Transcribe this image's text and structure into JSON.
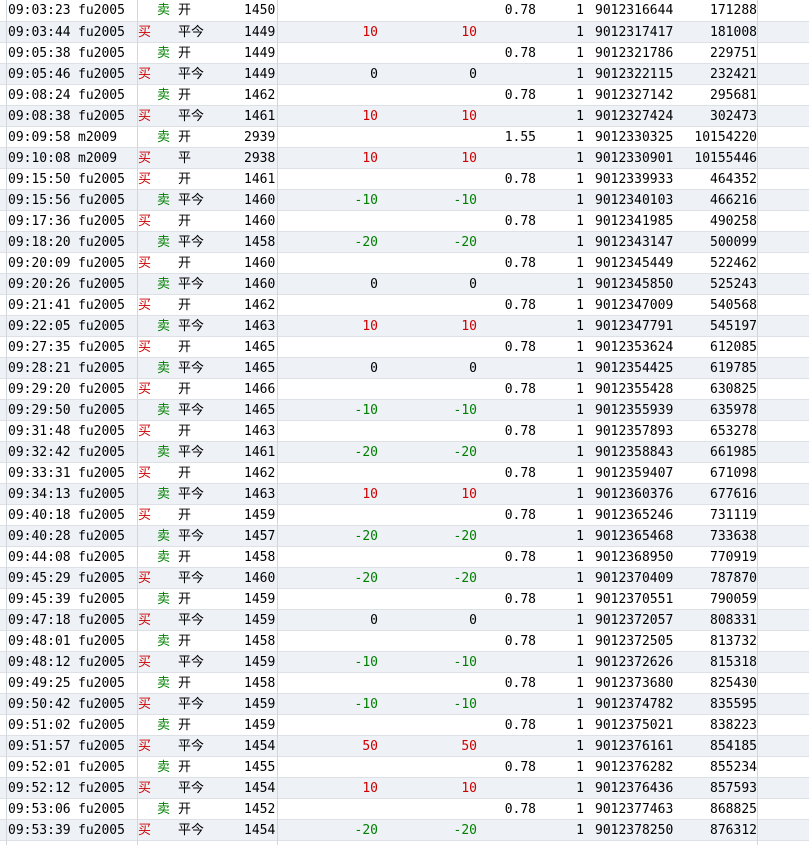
{
  "colors": {
    "buy": "#cc0000",
    "sell": "#008000",
    "row_alt": "#eef1f6"
  },
  "rows": [
    {
      "time": "09:03:23",
      "symbol": "fu2005",
      "side": "卖",
      "oc": "开",
      "price": "1450",
      "pnl1": "",
      "pnl2": "",
      "fee": "0.78",
      "qty": "1",
      "order": "9012316644",
      "trade": "171288"
    },
    {
      "time": "09:03:44",
      "symbol": "fu2005",
      "side": "买",
      "oc": "平今",
      "price": "1449",
      "pnl1": "10",
      "pnl2": "10",
      "fee": "",
      "qty": "1",
      "order": "9012317417",
      "trade": "181008"
    },
    {
      "time": "09:05:38",
      "symbol": "fu2005",
      "side": "卖",
      "oc": "开",
      "price": "1449",
      "pnl1": "",
      "pnl2": "",
      "fee": "0.78",
      "qty": "1",
      "order": "9012321786",
      "trade": "229751"
    },
    {
      "time": "09:05:46",
      "symbol": "fu2005",
      "side": "买",
      "oc": "平今",
      "price": "1449",
      "pnl1": "0",
      "pnl2": "0",
      "fee": "",
      "qty": "1",
      "order": "9012322115",
      "trade": "232421"
    },
    {
      "time": "09:08:24",
      "symbol": "fu2005",
      "side": "卖",
      "oc": "开",
      "price": "1462",
      "pnl1": "",
      "pnl2": "",
      "fee": "0.78",
      "qty": "1",
      "order": "9012327142",
      "trade": "295681"
    },
    {
      "time": "09:08:38",
      "symbol": "fu2005",
      "side": "买",
      "oc": "平今",
      "price": "1461",
      "pnl1": "10",
      "pnl2": "10",
      "fee": "",
      "qty": "1",
      "order": "9012327424",
      "trade": "302473"
    },
    {
      "time": "09:09:58",
      "symbol": "m2009",
      "side": "卖",
      "oc": "开",
      "price": "2939",
      "pnl1": "",
      "pnl2": "",
      "fee": "1.55",
      "qty": "1",
      "order": "9012330325",
      "trade": "10154220"
    },
    {
      "time": "09:10:08",
      "symbol": "m2009",
      "side": "买",
      "oc": "平",
      "price": "2938",
      "pnl1": "10",
      "pnl2": "10",
      "fee": "",
      "qty": "1",
      "order": "9012330901",
      "trade": "10155446"
    },
    {
      "time": "09:15:50",
      "symbol": "fu2005",
      "side": "买",
      "oc": "开",
      "price": "1461",
      "pnl1": "",
      "pnl2": "",
      "fee": "0.78",
      "qty": "1",
      "order": "9012339933",
      "trade": "464352"
    },
    {
      "time": "09:15:56",
      "symbol": "fu2005",
      "side": "卖",
      "oc": "平今",
      "price": "1460",
      "pnl1": "-10",
      "pnl2": "-10",
      "fee": "",
      "qty": "1",
      "order": "9012340103",
      "trade": "466216"
    },
    {
      "time": "09:17:36",
      "symbol": "fu2005",
      "side": "买",
      "oc": "开",
      "price": "1460",
      "pnl1": "",
      "pnl2": "",
      "fee": "0.78",
      "qty": "1",
      "order": "9012341985",
      "trade": "490258"
    },
    {
      "time": "09:18:20",
      "symbol": "fu2005",
      "side": "卖",
      "oc": "平今",
      "price": "1458",
      "pnl1": "-20",
      "pnl2": "-20",
      "fee": "",
      "qty": "1",
      "order": "9012343147",
      "trade": "500099"
    },
    {
      "time": "09:20:09",
      "symbol": "fu2005",
      "side": "买",
      "oc": "开",
      "price": "1460",
      "pnl1": "",
      "pnl2": "",
      "fee": "0.78",
      "qty": "1",
      "order": "9012345449",
      "trade": "522462"
    },
    {
      "time": "09:20:26",
      "symbol": "fu2005",
      "side": "卖",
      "oc": "平今",
      "price": "1460",
      "pnl1": "0",
      "pnl2": "0",
      "fee": "",
      "qty": "1",
      "order": "9012345850",
      "trade": "525243"
    },
    {
      "time": "09:21:41",
      "symbol": "fu2005",
      "side": "买",
      "oc": "开",
      "price": "1462",
      "pnl1": "",
      "pnl2": "",
      "fee": "0.78",
      "qty": "1",
      "order": "9012347009",
      "trade": "540568"
    },
    {
      "time": "09:22:05",
      "symbol": "fu2005",
      "side": "卖",
      "oc": "平今",
      "price": "1463",
      "pnl1": "10",
      "pnl2": "10",
      "fee": "",
      "qty": "1",
      "order": "9012347791",
      "trade": "545197"
    },
    {
      "time": "09:27:35",
      "symbol": "fu2005",
      "side": "买",
      "oc": "开",
      "price": "1465",
      "pnl1": "",
      "pnl2": "",
      "fee": "0.78",
      "qty": "1",
      "order": "9012353624",
      "trade": "612085"
    },
    {
      "time": "09:28:21",
      "symbol": "fu2005",
      "side": "卖",
      "oc": "平今",
      "price": "1465",
      "pnl1": "0",
      "pnl2": "0",
      "fee": "",
      "qty": "1",
      "order": "9012354425",
      "trade": "619785"
    },
    {
      "time": "09:29:20",
      "symbol": "fu2005",
      "side": "买",
      "oc": "开",
      "price": "1466",
      "pnl1": "",
      "pnl2": "",
      "fee": "0.78",
      "qty": "1",
      "order": "9012355428",
      "trade": "630825"
    },
    {
      "time": "09:29:50",
      "symbol": "fu2005",
      "side": "卖",
      "oc": "平今",
      "price": "1465",
      "pnl1": "-10",
      "pnl2": "-10",
      "fee": "",
      "qty": "1",
      "order": "9012355939",
      "trade": "635978"
    },
    {
      "time": "09:31:48",
      "symbol": "fu2005",
      "side": "买",
      "oc": "开",
      "price": "1463",
      "pnl1": "",
      "pnl2": "",
      "fee": "0.78",
      "qty": "1",
      "order": "9012357893",
      "trade": "653278"
    },
    {
      "time": "09:32:42",
      "symbol": "fu2005",
      "side": "卖",
      "oc": "平今",
      "price": "1461",
      "pnl1": "-20",
      "pnl2": "-20",
      "fee": "",
      "qty": "1",
      "order": "9012358843",
      "trade": "661985"
    },
    {
      "time": "09:33:31",
      "symbol": "fu2005",
      "side": "买",
      "oc": "开",
      "price": "1462",
      "pnl1": "",
      "pnl2": "",
      "fee": "0.78",
      "qty": "1",
      "order": "9012359407",
      "trade": "671098"
    },
    {
      "time": "09:34:13",
      "symbol": "fu2005",
      "side": "卖",
      "oc": "平今",
      "price": "1463",
      "pnl1": "10",
      "pnl2": "10",
      "fee": "",
      "qty": "1",
      "order": "9012360376",
      "trade": "677616"
    },
    {
      "time": "09:40:18",
      "symbol": "fu2005",
      "side": "买",
      "oc": "开",
      "price": "1459",
      "pnl1": "",
      "pnl2": "",
      "fee": "0.78",
      "qty": "1",
      "order": "9012365246",
      "trade": "731119"
    },
    {
      "time": "09:40:28",
      "symbol": "fu2005",
      "side": "卖",
      "oc": "平今",
      "price": "1457",
      "pnl1": "-20",
      "pnl2": "-20",
      "fee": "",
      "qty": "1",
      "order": "9012365468",
      "trade": "733638"
    },
    {
      "time": "09:44:08",
      "symbol": "fu2005",
      "side": "卖",
      "oc": "开",
      "price": "1458",
      "pnl1": "",
      "pnl2": "",
      "fee": "0.78",
      "qty": "1",
      "order": "9012368950",
      "trade": "770919"
    },
    {
      "time": "09:45:29",
      "symbol": "fu2005",
      "side": "买",
      "oc": "平今",
      "price": "1460",
      "pnl1": "-20",
      "pnl2": "-20",
      "fee": "",
      "qty": "1",
      "order": "9012370409",
      "trade": "787870"
    },
    {
      "time": "09:45:39",
      "symbol": "fu2005",
      "side": "卖",
      "oc": "开",
      "price": "1459",
      "pnl1": "",
      "pnl2": "",
      "fee": "0.78",
      "qty": "1",
      "order": "9012370551",
      "trade": "790059"
    },
    {
      "time": "09:47:18",
      "symbol": "fu2005",
      "side": "买",
      "oc": "平今",
      "price": "1459",
      "pnl1": "0",
      "pnl2": "0",
      "fee": "",
      "qty": "1",
      "order": "9012372057",
      "trade": "808331"
    },
    {
      "time": "09:48:01",
      "symbol": "fu2005",
      "side": "卖",
      "oc": "开",
      "price": "1458",
      "pnl1": "",
      "pnl2": "",
      "fee": "0.78",
      "qty": "1",
      "order": "9012372505",
      "trade": "813732"
    },
    {
      "time": "09:48:12",
      "symbol": "fu2005",
      "side": "买",
      "oc": "平今",
      "price": "1459",
      "pnl1": "-10",
      "pnl2": "-10",
      "fee": "",
      "qty": "1",
      "order": "9012372626",
      "trade": "815318"
    },
    {
      "time": "09:49:25",
      "symbol": "fu2005",
      "side": "卖",
      "oc": "开",
      "price": "1458",
      "pnl1": "",
      "pnl2": "",
      "fee": "0.78",
      "qty": "1",
      "order": "9012373680",
      "trade": "825430"
    },
    {
      "time": "09:50:42",
      "symbol": "fu2005",
      "side": "买",
      "oc": "平今",
      "price": "1459",
      "pnl1": "-10",
      "pnl2": "-10",
      "fee": "",
      "qty": "1",
      "order": "9012374782",
      "trade": "835595"
    },
    {
      "time": "09:51:02",
      "symbol": "fu2005",
      "side": "卖",
      "oc": "开",
      "price": "1459",
      "pnl1": "",
      "pnl2": "",
      "fee": "0.78",
      "qty": "1",
      "order": "9012375021",
      "trade": "838223"
    },
    {
      "time": "09:51:57",
      "symbol": "fu2005",
      "side": "买",
      "oc": "平今",
      "price": "1454",
      "pnl1": "50",
      "pnl2": "50",
      "fee": "",
      "qty": "1",
      "order": "9012376161",
      "trade": "854185"
    },
    {
      "time": "09:52:01",
      "symbol": "fu2005",
      "side": "卖",
      "oc": "开",
      "price": "1455",
      "pnl1": "",
      "pnl2": "",
      "fee": "0.78",
      "qty": "1",
      "order": "9012376282",
      "trade": "855234"
    },
    {
      "time": "09:52:12",
      "symbol": "fu2005",
      "side": "买",
      "oc": "平今",
      "price": "1454",
      "pnl1": "10",
      "pnl2": "10",
      "fee": "",
      "qty": "1",
      "order": "9012376436",
      "trade": "857593"
    },
    {
      "time": "09:53:06",
      "symbol": "fu2005",
      "side": "卖",
      "oc": "开",
      "price": "1452",
      "pnl1": "",
      "pnl2": "",
      "fee": "0.78",
      "qty": "1",
      "order": "9012377463",
      "trade": "868825"
    },
    {
      "time": "09:53:39",
      "symbol": "fu2005",
      "side": "买",
      "oc": "平今",
      "price": "1454",
      "pnl1": "-20",
      "pnl2": "-20",
      "fee": "",
      "qty": "1",
      "order": "9012378250",
      "trade": "876312"
    }
  ]
}
